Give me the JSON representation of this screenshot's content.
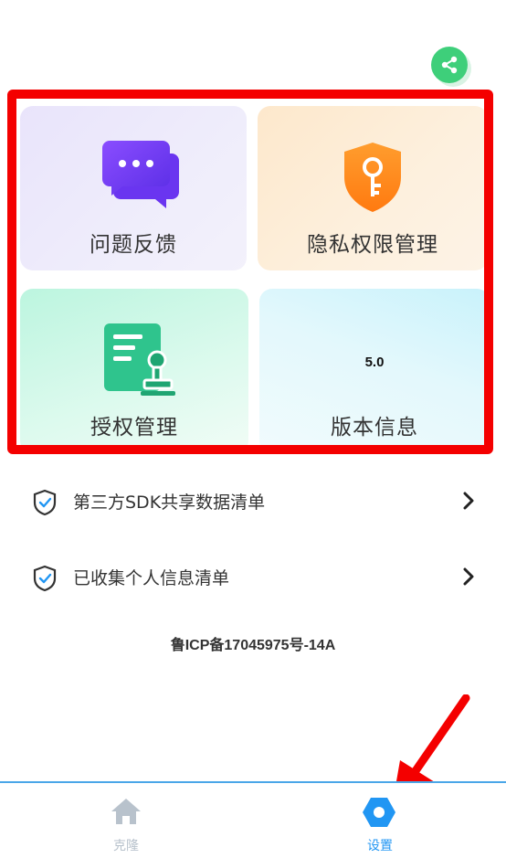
{
  "cards": {
    "feedback": {
      "label": "问题反馈",
      "icon": "chat-bubbles-icon"
    },
    "privacy": {
      "label": "隐私权限管理",
      "icon": "key-shield-icon"
    },
    "authorization": {
      "label": "授权管理",
      "icon": "document-stamp-icon"
    },
    "version": {
      "label": "版本信息",
      "value": "5.0"
    }
  },
  "list": [
    {
      "label": "第三方SDK共享数据清单",
      "icon": "shield-check-icon"
    },
    {
      "label": "已收集个人信息清单",
      "icon": "shield-check-icon"
    }
  ],
  "icp": "鲁ICP备17045975号-14A",
  "tabs": [
    {
      "label": "克隆",
      "icon": "home-icon",
      "active": false
    },
    {
      "label": "设置",
      "icon": "settings-icon",
      "active": true
    }
  ],
  "colors": {
    "accent": "#2196f3",
    "highlight_border": "#f40000",
    "share": "#3ecf7a",
    "inactive_tab": "#b8c2cc"
  }
}
